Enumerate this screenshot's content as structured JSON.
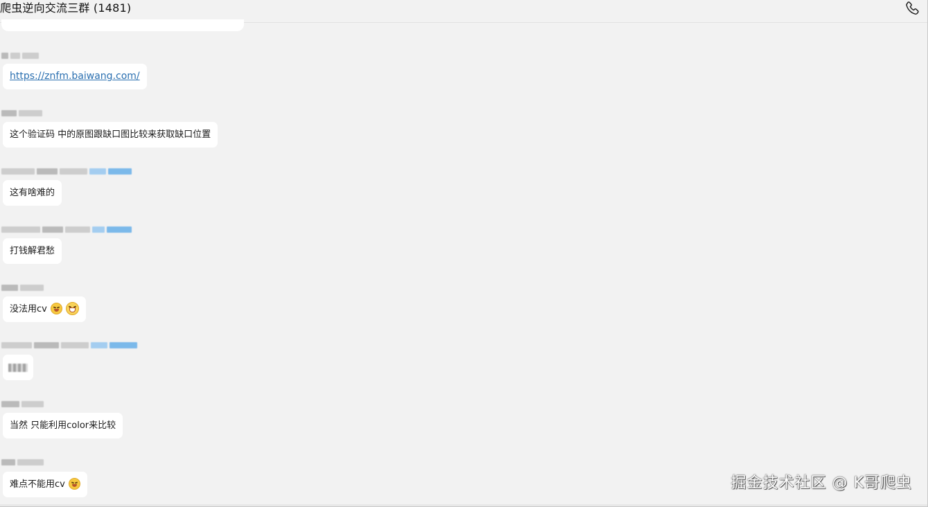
{
  "window": {
    "title": "爬虫逆向交流三群 (1481)"
  },
  "header": {
    "call_icon": "phone-icon"
  },
  "messages": [
    {
      "type": "link",
      "text": "https://znfm.baiwang.com/"
    },
    {
      "type": "text",
      "text": "这个验证码 中的原图跟缺口图比较来获取缺口位置"
    },
    {
      "type": "text",
      "text": "这有啥难的"
    },
    {
      "type": "text",
      "text": "打钱解君愁"
    },
    {
      "type": "text",
      "text": "没法用cv",
      "emojis": [
        "smirk-emoji",
        "grin-emoji"
      ]
    },
    {
      "type": "censored",
      "text": ""
    },
    {
      "type": "text",
      "text": "当然 只能利用color来比较"
    },
    {
      "type": "text",
      "text": "难点不能用cv",
      "emojis": [
        "smirk-emoji"
      ]
    }
  ],
  "watermark": "掘金技术社区 @ K哥爬虫",
  "colors": {
    "background": "#f2f2f2",
    "bubble": "#ffffff",
    "link": "#2a6fb0"
  }
}
